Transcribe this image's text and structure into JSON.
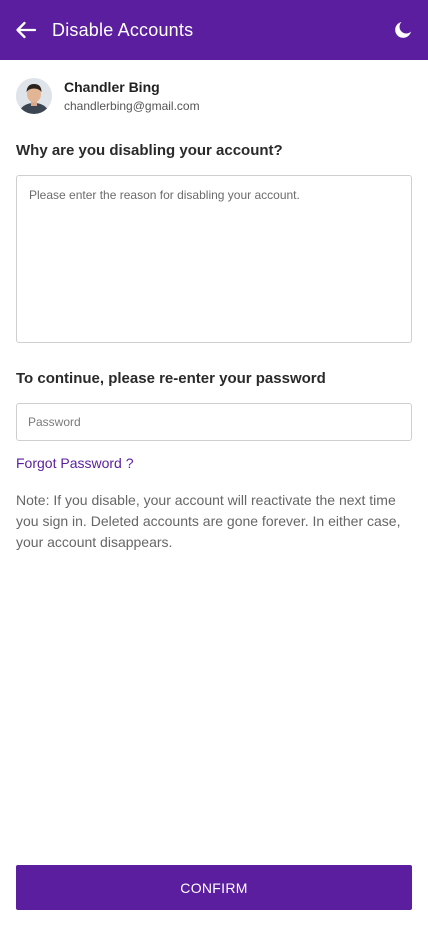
{
  "app_bar": {
    "title": "Disable Accounts",
    "back_icon": "arrow-left-icon",
    "theme_icon": "moon-icon",
    "background": "#5a1e9e"
  },
  "profile": {
    "name": "Chandler Bing",
    "email": "chandlerbing@gmail.com"
  },
  "reason": {
    "question": "Why are you disabling your account?",
    "placeholder": "Please enter the reason for disabling your account.",
    "value": ""
  },
  "password": {
    "heading": "To continue, please re-enter your password",
    "placeholder": "Password",
    "value": ""
  },
  "forgot_label": "Forgot Password ?",
  "note": "Note: If you disable, your account will reactivate the next time you sign in. Deleted accounts are gone forever. In either case, your account disappears.",
  "confirm_label": "CONFIRM",
  "colors": {
    "accent": "#5a1e9e",
    "link": "#5a1e9e",
    "border": "#cfcfcf"
  }
}
